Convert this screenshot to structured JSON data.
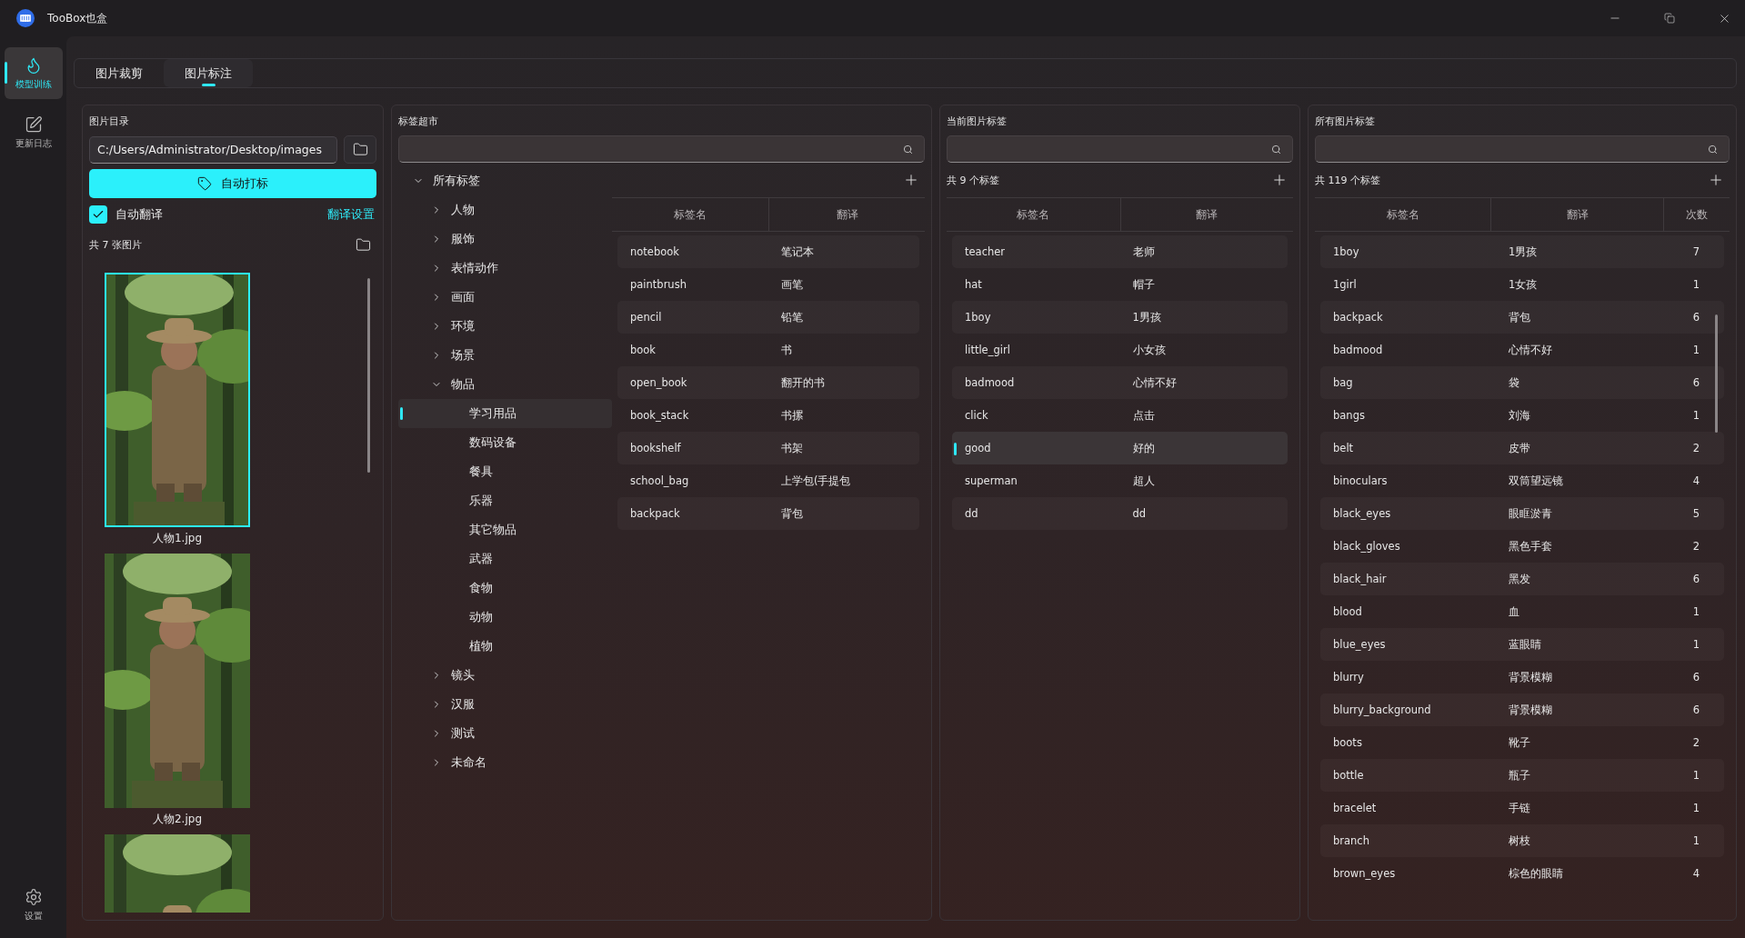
{
  "app": {
    "title": "TooBox也盒"
  },
  "nav": [
    {
      "label": "模型训练",
      "kind": "flame",
      "selected": true
    },
    {
      "label": "更新日志",
      "kind": "edit",
      "selected": false
    }
  ],
  "nav_bottom": {
    "label": "设置"
  },
  "tabs": [
    {
      "label": "图片裁剪",
      "selected": false
    },
    {
      "label": "图片标注",
      "selected": true
    }
  ],
  "images_panel": {
    "title": "图片目录",
    "path": "C:/Users/Administrator/Desktop/images",
    "auto_tag_button": "自动打标",
    "auto_translate": {
      "label": "自动翻译",
      "checked": true
    },
    "translate_settings": "翻译设置",
    "count": "共 7 张图片",
    "images": [
      {
        "caption": "人物1.jpg",
        "selected": true
      },
      {
        "caption": "人物2.jpg",
        "selected": false
      },
      {
        "selected": false
      }
    ]
  },
  "market_panel": {
    "title": "标签超市",
    "tree": {
      "label": "所有标签",
      "expanded": true,
      "selected": false,
      "children": [
        {
          "label": "人物",
          "expanded": false,
          "selected": false
        },
        {
          "label": "服饰",
          "expanded": false,
          "selected": false
        },
        {
          "label": "表情动作",
          "expanded": false,
          "selected": false
        },
        {
          "label": "画面",
          "expanded": false,
          "selected": false
        },
        {
          "label": "环境",
          "expanded": false,
          "selected": false
        },
        {
          "label": "场景",
          "expanded": false,
          "selected": false
        },
        {
          "label": "物品",
          "expanded": true,
          "selected": false,
          "children": [
            {
              "label": "学习用品",
              "selected": true
            },
            {
              "label": "数码设备",
              "selected": false
            },
            {
              "label": "餐具",
              "selected": false
            },
            {
              "label": "乐器",
              "selected": false
            },
            {
              "label": "其它物品",
              "selected": false
            },
            {
              "label": "武器",
              "selected": false
            },
            {
              "label": "食物",
              "selected": false
            },
            {
              "label": "动物",
              "selected": false
            },
            {
              "label": "植物",
              "selected": false
            }
          ]
        },
        {
          "label": "镜头",
          "expanded": false,
          "selected": false
        },
        {
          "label": "汉服",
          "expanded": false,
          "selected": false
        },
        {
          "label": "测试",
          "expanded": false,
          "selected": false
        },
        {
          "label": "未命名",
          "expanded": false,
          "selected": false
        }
      ]
    },
    "columns": [
      "标签名",
      "翻译"
    ],
    "rows": [
      {
        "name": "notebook",
        "translation": "笔记本"
      },
      {
        "name": "paintbrush",
        "translation": "画笔"
      },
      {
        "name": "pencil",
        "translation": "铅笔"
      },
      {
        "name": "book",
        "translation": "书"
      },
      {
        "name": "open_book",
        "translation": "翻开的书"
      },
      {
        "name": "book_stack",
        "translation": "书摞"
      },
      {
        "name": "bookshelf",
        "translation": "书架"
      },
      {
        "name": "school_bag",
        "translation": "上学包(手提包"
      },
      {
        "name": "backpack",
        "translation": "背包"
      }
    ]
  },
  "current_panel": {
    "title": "当前图片标签",
    "count": "共 9 个标签",
    "columns": [
      "标签名",
      "翻译"
    ],
    "rows": [
      {
        "name": "teacher",
        "translation": "老师",
        "selected": false
      },
      {
        "name": "hat",
        "translation": "帽子",
        "selected": false
      },
      {
        "name": "1boy",
        "translation": "1男孩",
        "selected": false
      },
      {
        "name": "little_girl",
        "translation": "小女孩",
        "selected": false
      },
      {
        "name": "badmood",
        "translation": "心情不好",
        "selected": false
      },
      {
        "name": "click",
        "translation": "点击",
        "selected": false
      },
      {
        "name": "good",
        "translation": "好的",
        "selected": true
      },
      {
        "name": "superman",
        "translation": "超人",
        "selected": false
      },
      {
        "name": "dd",
        "translation": "dd",
        "selected": false
      }
    ]
  },
  "all_panel": {
    "title": "所有图片标签",
    "count": "共 119 个标签",
    "columns": [
      "标签名",
      "翻译",
      "次数"
    ],
    "rows": [
      {
        "name": "1boy",
        "translation": "1男孩",
        "count": "7"
      },
      {
        "name": "1girl",
        "translation": "1女孩",
        "count": "1"
      },
      {
        "name": "backpack",
        "translation": "背包",
        "count": "6"
      },
      {
        "name": "badmood",
        "translation": "心情不好",
        "count": "1"
      },
      {
        "name": "bag",
        "translation": "袋",
        "count": "6"
      },
      {
        "name": "bangs",
        "translation": "刘海",
        "count": "1"
      },
      {
        "name": "belt",
        "translation": "皮带",
        "count": "2"
      },
      {
        "name": "binoculars",
        "translation": "双筒望远镜",
        "count": "4"
      },
      {
        "name": "black_eyes",
        "translation": "眼眶淤青",
        "count": "5"
      },
      {
        "name": "black_gloves",
        "translation": "黑色手套",
        "count": "2"
      },
      {
        "name": "black_hair",
        "translation": "黑发",
        "count": "6"
      },
      {
        "name": "blood",
        "translation": "血",
        "count": "1"
      },
      {
        "name": "blue_eyes",
        "translation": "蓝眼睛",
        "count": "1"
      },
      {
        "name": "blurry",
        "translation": "背景模糊",
        "count": "6"
      },
      {
        "name": "blurry_background",
        "translation": "背景模糊",
        "count": "6"
      },
      {
        "name": "boots",
        "translation": "靴子",
        "count": "2"
      },
      {
        "name": "bottle",
        "translation": "瓶子",
        "count": "1"
      },
      {
        "name": "bracelet",
        "translation": "手链",
        "count": "1"
      },
      {
        "name": "branch",
        "translation": "树枝",
        "count": "1"
      },
      {
        "name": "brown_eyes",
        "translation": "棕色的眼睛",
        "count": "4"
      }
    ]
  }
}
